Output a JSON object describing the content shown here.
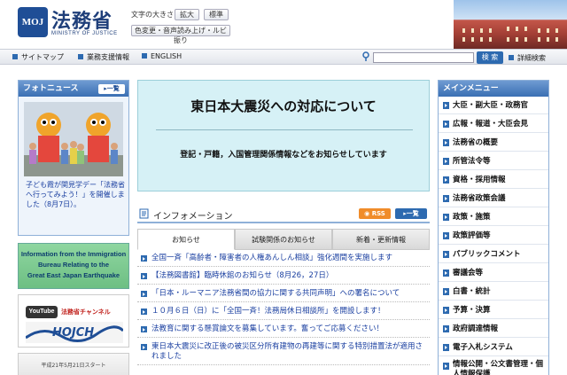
{
  "header": {
    "logo_mark": "MOJ",
    "title": "法務省",
    "subtitle": "MINISTRY OF JUSTICE",
    "fontsize_label": "文字の大きさ",
    "fontsize_large": "拡大",
    "fontsize_standard": "標準",
    "color_tools": "色変更・音声読み上げ・ルビ振り"
  },
  "utilbar": {
    "sitemap": "サイトマップ",
    "business": "業務支援情報",
    "english": "ENGLISH",
    "search_placeholder": "",
    "search_button": "検 索",
    "advanced": "詳細検索"
  },
  "photo_news": {
    "title": "フォトニュース",
    "list_button": "一覧",
    "caption": "子ども霞が関見学デー「法務省へ行ってみよう！」を開催しました（8月7日）。"
  },
  "banners": {
    "immigration": [
      "Information from the Immigration",
      "Bureau Relating to the",
      "Great East Japan Earthquake"
    ],
    "youtube_logo": "YouTube",
    "youtube_text": "法務省チャンネル",
    "judge": "平成21年5月21日スタート"
  },
  "quake": {
    "title": "東日本大震災への対応について",
    "subtitle": "登記・戸籍，入国管理関係情報などをお知らせしています"
  },
  "info": {
    "title": "インフォメーション",
    "rss": "RSS",
    "list_button": "一覧",
    "tabs": [
      "お知らせ",
      "試験関係のお知らせ",
      "新着・更新情報"
    ],
    "items": [
      "全国一斉「高齢者・障害者の人権あんしん相談」強化週間を実施します",
      "【法務図書館】臨時休館のお知らせ（8月26，27日）",
      "「日本・ルーマニア法務省間の協力に関する共同声明」への署名について",
      "１０月６日（日）に「全国一斉！法務局休日相談所」を開設します！",
      "法教育に関する懸賞論文を募集しています。奮ってご応募ください！",
      "東日本大震災に改正後の被災区分所有建物の再建等に関する特別措置法が適用されました"
    ]
  },
  "menu": {
    "title": "メインメニュー",
    "items": [
      "大臣・副大臣・政務官",
      "広報・報道・大臣会見",
      "法務省の概要",
      "所管法令等",
      "資格・採用情報",
      "法務省政策会議",
      "政策・施策",
      "政策評価等",
      "パブリックコメント",
      "審議会等",
      "白書・統計",
      "予算・決算",
      "政府調達情報",
      "電子入札システム",
      "情報公開・公文書管理・個人情報保護"
    ]
  },
  "colors": {
    "brand_blue": "#1f4e96",
    "link": "#1a3fa0",
    "quake_bg": "#d6f1f6",
    "rss_orange": "#f08c2a"
  }
}
